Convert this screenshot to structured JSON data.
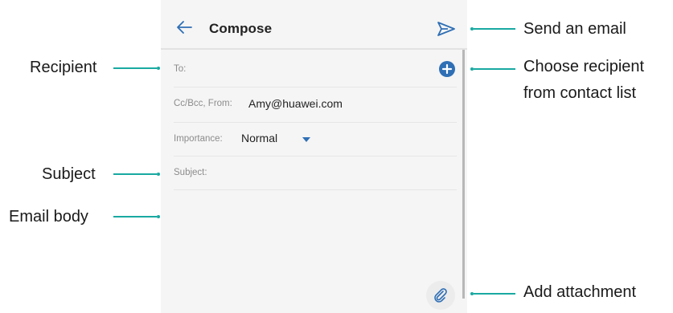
{
  "app": {
    "title": "Compose"
  },
  "fields": {
    "to_label": "To:",
    "ccbcc_label": "Cc/Bcc, From:",
    "from_value": "Amy@huawei.com",
    "importance_label": "Importance:",
    "importance_value": "Normal",
    "subject_label": "Subject:"
  },
  "annotations": {
    "send": "Send an email",
    "choose_line1": "Choose recipient",
    "choose_line2": "from contact list",
    "recipient": "Recipient",
    "subject": "Subject",
    "body": "Email body",
    "attachment": "Add attachment"
  },
  "icons": {
    "back": "back-arrow-icon",
    "send": "send-icon",
    "add": "add-recipient-icon",
    "dropdown": "caret-down-icon",
    "attach": "paperclip-icon"
  },
  "colors": {
    "accent": "#2f6fb5",
    "annotation": "#19a9a1",
    "background": "#f5f5f5"
  }
}
